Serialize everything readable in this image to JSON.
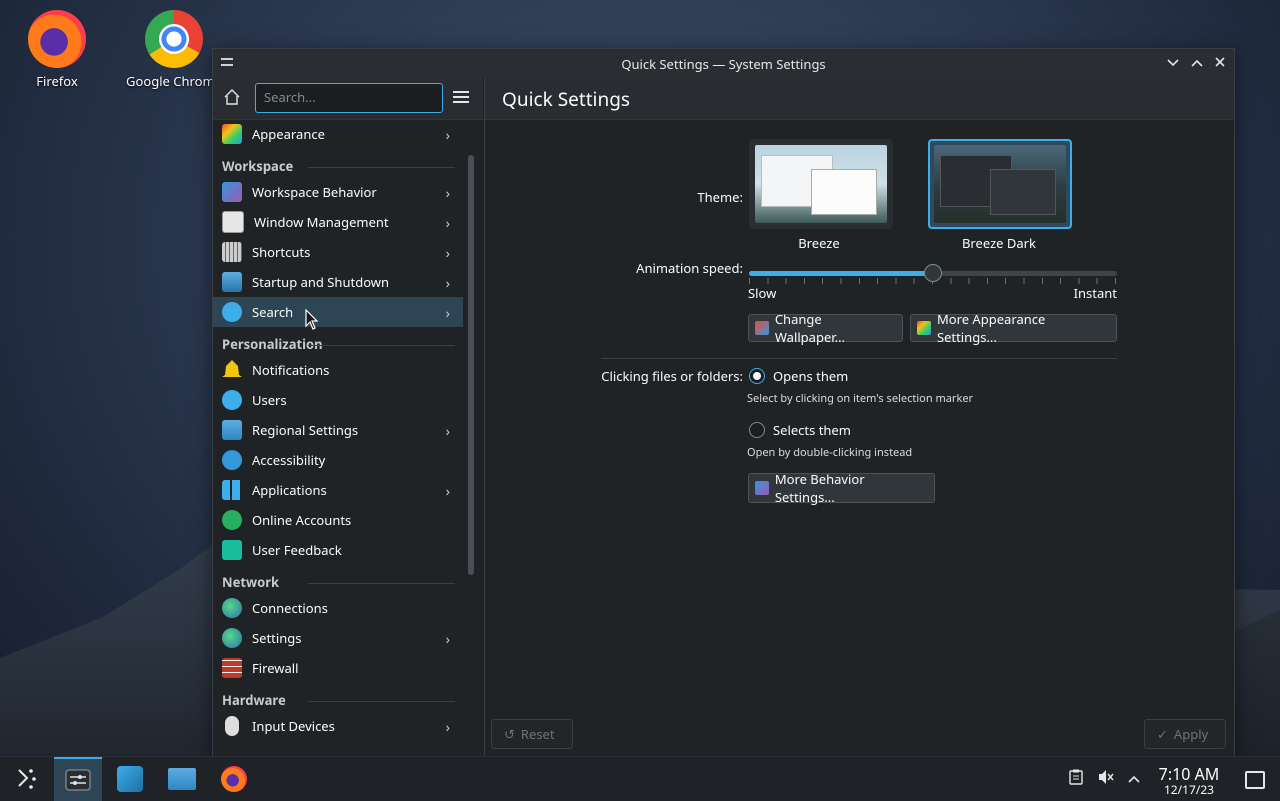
{
  "desktop": {
    "icons": [
      {
        "label": "Firefox"
      },
      {
        "label": "Google Chrome"
      }
    ]
  },
  "window": {
    "title": "Quick Settings — System Settings",
    "controls": {
      "minimize": "⌄",
      "maximize": "⌃",
      "close": "✕"
    }
  },
  "sidebar": {
    "search_placeholder": "Search...",
    "top_items": [
      {
        "label": "Appearance",
        "icon": "appearance-icon",
        "has_children": true
      }
    ],
    "categories": [
      {
        "title": "Workspace",
        "items": [
          {
            "label": "Workspace Behavior",
            "icon": "workspace-behavior-icon",
            "has_children": true
          },
          {
            "label": "Window Management",
            "icon": "window-management-icon",
            "has_children": true
          },
          {
            "label": "Shortcuts",
            "icon": "keyboard-icon",
            "has_children": true
          },
          {
            "label": "Startup and Shutdown",
            "icon": "startup-icon",
            "has_children": true
          },
          {
            "label": "Search",
            "icon": "search-icon",
            "has_children": true,
            "active": true
          }
        ]
      },
      {
        "title": "Personalization",
        "items": [
          {
            "label": "Notifications",
            "icon": "bell-icon",
            "has_children": false
          },
          {
            "label": "Users",
            "icon": "users-icon",
            "has_children": false
          },
          {
            "label": "Regional Settings",
            "icon": "regional-icon",
            "has_children": true
          },
          {
            "label": "Accessibility",
            "icon": "accessibility-icon",
            "has_children": false
          },
          {
            "label": "Applications",
            "icon": "applications-icon",
            "has_children": true
          },
          {
            "label": "Online Accounts",
            "icon": "online-accounts-icon",
            "has_children": false
          },
          {
            "label": "User Feedback",
            "icon": "feedback-icon",
            "has_children": false
          }
        ]
      },
      {
        "title": "Network",
        "items": [
          {
            "label": "Connections",
            "icon": "globe-icon",
            "has_children": false
          },
          {
            "label": "Settings",
            "icon": "globe-icon",
            "has_children": true
          },
          {
            "label": "Firewall",
            "icon": "firewall-icon",
            "has_children": false
          }
        ]
      },
      {
        "title": "Hardware",
        "items": [
          {
            "label": "Input Devices",
            "icon": "mouse-icon",
            "has_children": true
          }
        ]
      }
    ]
  },
  "main": {
    "title": "Quick Settings",
    "theme_label": "Theme:",
    "themes": [
      {
        "name": "Breeze",
        "selected": false
      },
      {
        "name": "Breeze Dark",
        "selected": true
      }
    ],
    "animation_label": "Animation speed:",
    "animation_min": "Slow",
    "animation_max": "Instant",
    "animation_value": 0.5,
    "change_wallpaper": "Change Wallpaper...",
    "more_appearance": "More Appearance Settings...",
    "clicking_label": "Clicking files or folders:",
    "opt_open": "Opens them",
    "opt_open_hint": "Select by clicking on item's selection marker",
    "opt_select": "Selects them",
    "opt_select_hint": "Open by double-clicking instead",
    "selected_option": "open",
    "more_behavior": "More Behavior Settings...",
    "reset": "Reset",
    "apply": "Apply"
  },
  "taskbar": {
    "time": "7:10 AM",
    "date": "12/17/23"
  },
  "colors": {
    "accent": "#3daee9",
    "window_bg": "#202326",
    "header_bg": "#292c30",
    "active_item": "#2e4556"
  }
}
